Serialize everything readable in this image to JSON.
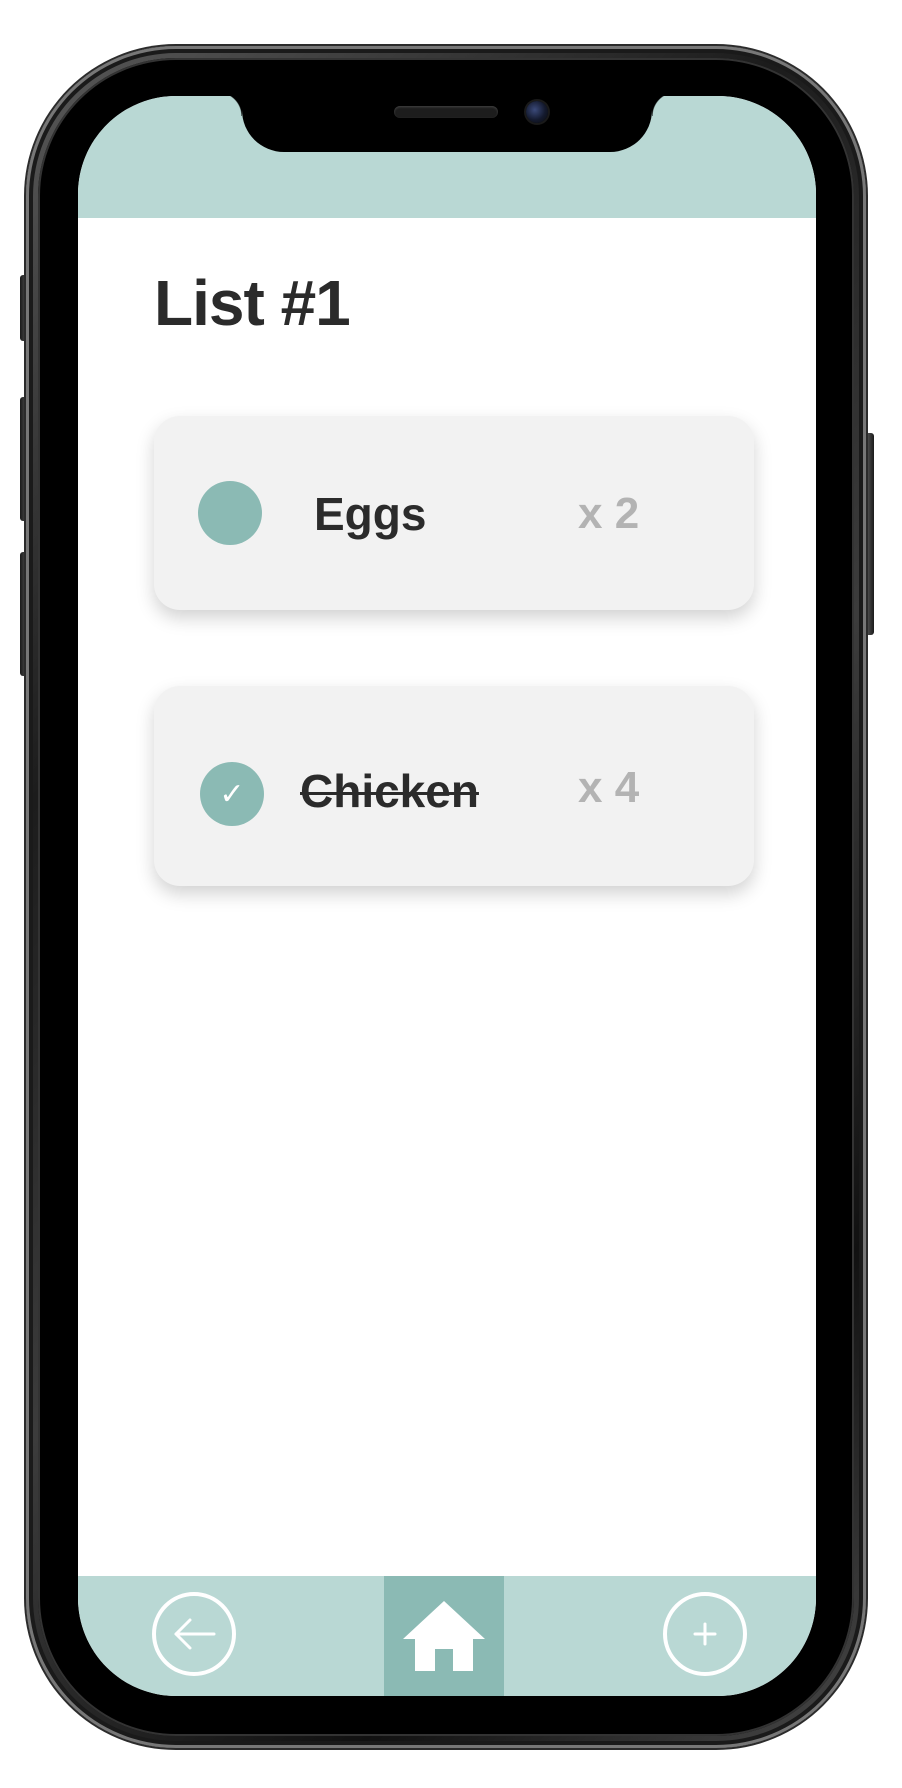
{
  "page": {
    "title": "List #1"
  },
  "items": [
    {
      "name": "Eggs",
      "quantity": "x 2",
      "checked": false
    },
    {
      "name": "Chicken",
      "quantity": "x 4",
      "checked": true,
      "check_glyph": "✓"
    }
  ],
  "nav": {
    "back_icon": "arrow-left-icon",
    "home_icon": "home-icon",
    "add_icon": "plus-icon"
  },
  "colors": {
    "accent_light": "#b9d8d4",
    "accent": "#8bbab4",
    "card_bg": "#f2f2f2",
    "text_primary": "#2b2b2b",
    "text_muted": "#b3b3b3"
  }
}
